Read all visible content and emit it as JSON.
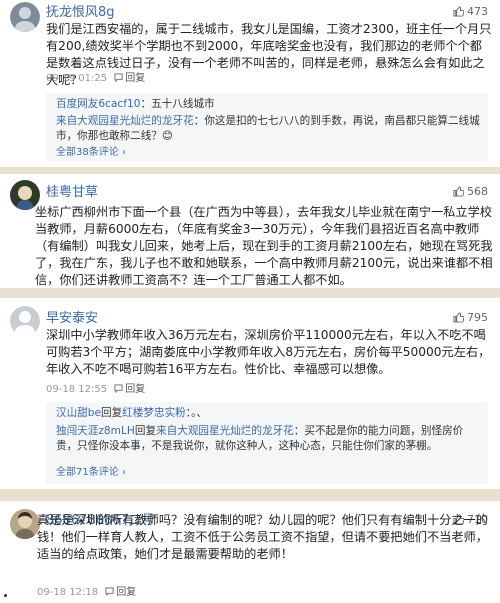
{
  "comments": [
    {
      "user": "抚龙恨风8g",
      "likes": "473",
      "body": "我们是江西安福的，属于二线城市，我女儿是国编，工资才2300，班主任一个月只有200,绩效奖半个学期也不到2000，年底啥奖金也没有，我们那边的老师个个都是数着这点钱过日子，没有一个老师不叫苦的，同样是老师，悬殊怎么会有如此之大呢？",
      "time": "09-19 01:25",
      "reply_label": "回复",
      "subreplies": [
        {
          "name": "百度网友6cacf10",
          "sep": "：",
          "text": "五十八线城市"
        },
        {
          "name": "来自大观园星光灿烂的龙牙花",
          "sep": "：",
          "text": "你这是扣的七七八八的到手数，再说，南昌都只能算二线城市，你那也敢称二线？😊"
        }
      ],
      "more": "全部38条评论 ›"
    },
    {
      "user": "桂粤甘草",
      "likes": "568",
      "body": "坐标广西柳州市下面一个县（在广西为中等县），去年我女儿毕业就在南宁一私立学校当教师，月薪6000左右，（年底有奖金3一30万元），今年我们县招近百名高中教师（有编制）叫我女儿回来，她考上后，现在到手的工资月薪2100左右，她现在骂死我了，我在广东，我儿子也不敢和她联系，一个高中教师月薪2100元，说出来谁都不相信，你们还讲教师工资高不？连一个工厂普通工人都不如。"
    },
    {
      "user": "早安泰安",
      "likes": "795",
      "body": "深圳中小学教师年收入36万元左右，深圳房价平110000元左右，年以入不吃不喝可购若3个平方；湖南娄底中小学教师年收入8万元左右，房价每平50000元左右，年收入不吃不喝可购若16平方左右。性价比、幸福感可以想像。",
      "time": "09-18 12:55",
      "reply_label": "回复",
      "subreplies": [
        {
          "name": "汉山甜be",
          "tag_prefix": "回复",
          "tag": "红楼梦忠实粉",
          "sep": "：",
          "text": "。、"
        },
        {
          "name": "独闯天涯z8mLH",
          "tag_prefix": "回复",
          "tag": "来自大观园星光灿烂的龙牙花",
          "sep": "：",
          "text": "买不起是你的能力问题，别怪房价贵，只怪你没本事，不是我说你，就你这种人，这种心态，只能住你们家的茅棚。"
        }
      ],
      "more": "全部71条评论 ›"
    },
    {
      "user": "8686786867二号",
      "likes": "710",
      "body": "真是是深圳的所有教师吗？没有编制的呢？幼儿园的呢？他们只有有编制十分之一的钱！他们一样育人教人，工资不低于公务员工资不指望，但请不要把她们不当老师，适当的给点政策，她们才是最需要帮助的老师！",
      "time": "09-18 12:18",
      "reply_label": "回复"
    }
  ],
  "colors": {
    "link": "#3b6aa6",
    "divider": "#e9e1cf",
    "subbox": "#f5f6f8"
  },
  "icons": {
    "like": "thumbs-up-icon",
    "reply": "reply-icon",
    "avatar": "user-avatar"
  }
}
